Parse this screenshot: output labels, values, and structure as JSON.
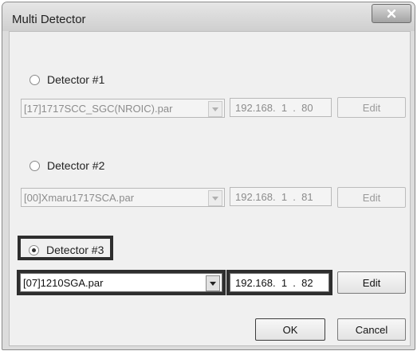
{
  "window": {
    "title": "Multi Detector"
  },
  "detectors": [
    {
      "label": "Detector #1",
      "selected": false,
      "file": "[17]1717SCC_SGC(NROIC).par",
      "ip": "192.168.  1  .  80",
      "edit_label": "Edit"
    },
    {
      "label": "Detector #2",
      "selected": false,
      "file": "[00]Xmaru1717SCA.par",
      "ip": "192.168.  1  .  81",
      "edit_label": "Edit"
    },
    {
      "label": "Detector #3",
      "selected": true,
      "file": "[07]1210SGA.par",
      "ip": "192.168.  1  .  82",
      "edit_label": "Edit"
    }
  ],
  "footer": {
    "ok_label": "OK",
    "cancel_label": "Cancel"
  },
  "icons": {
    "close": "close-icon",
    "dropdown": "chevron-down-icon"
  }
}
